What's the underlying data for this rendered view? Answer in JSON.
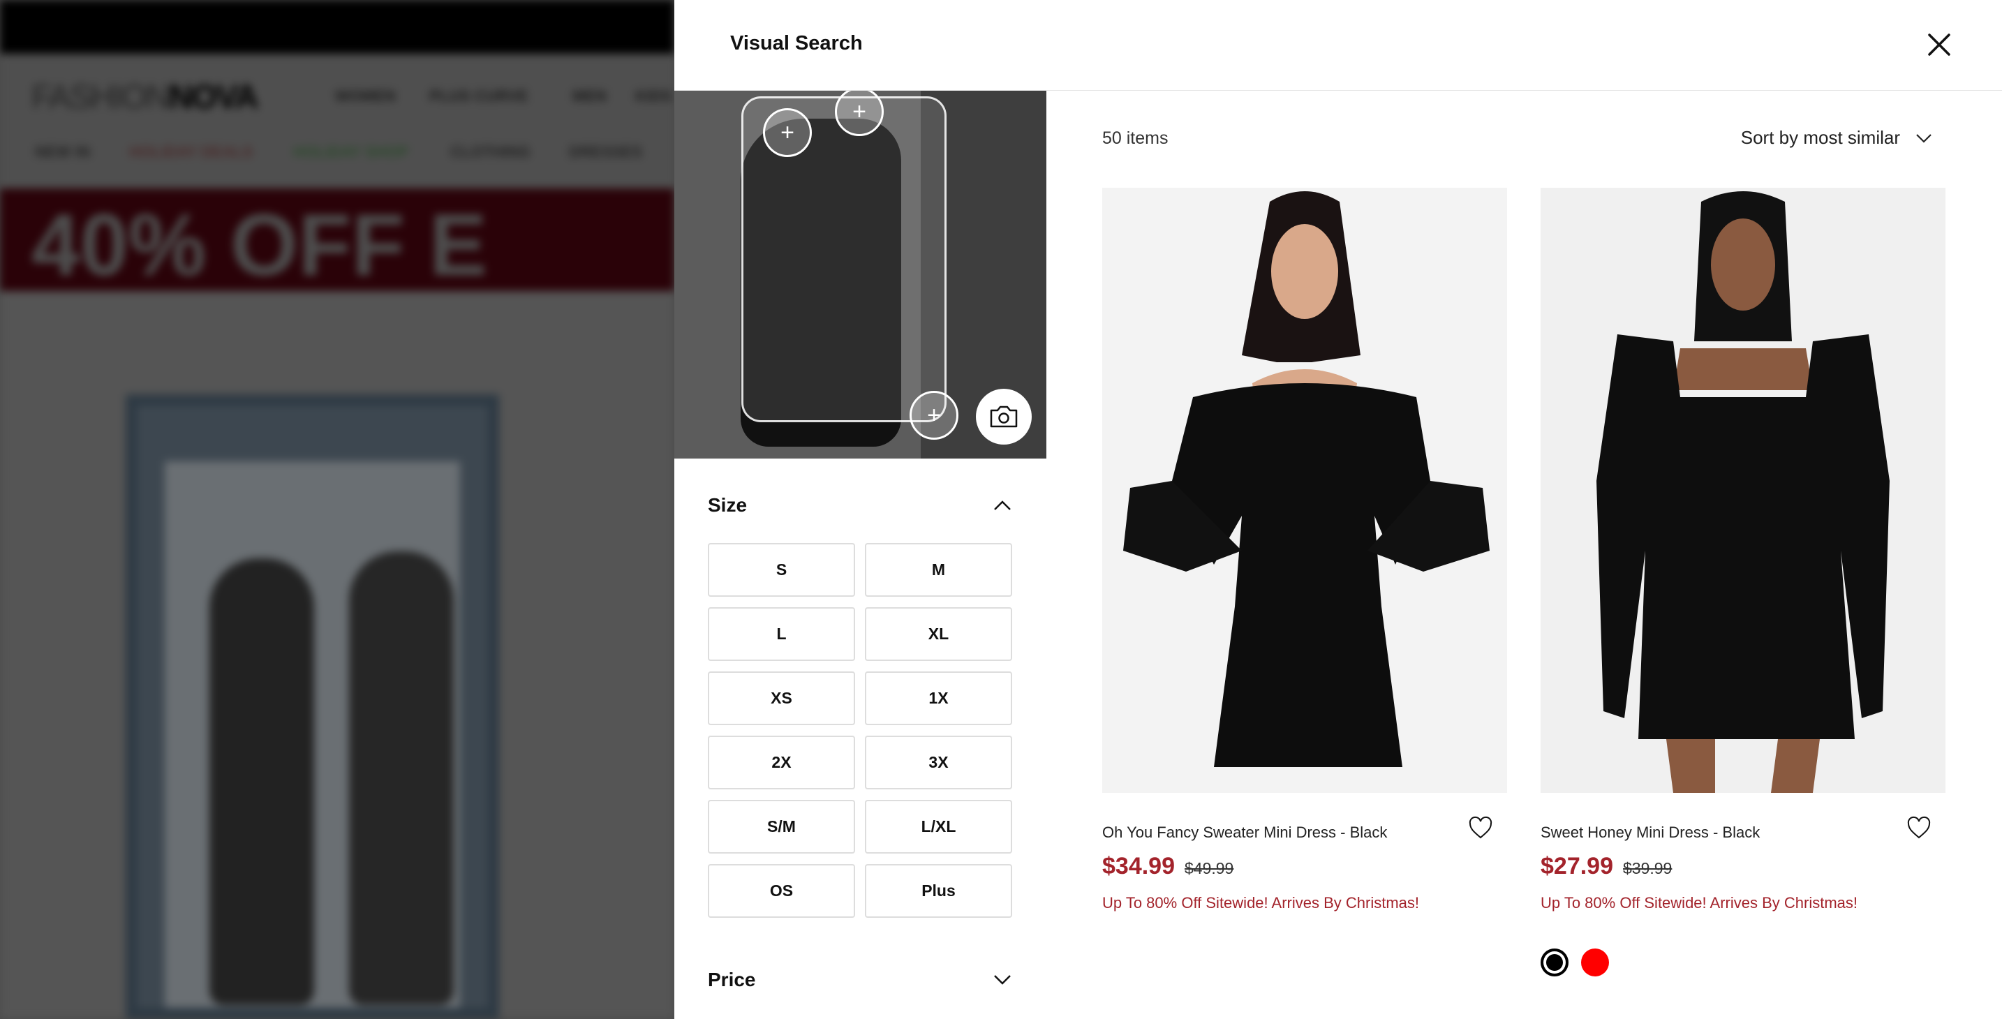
{
  "background_page": {
    "logo_light": "FASHION",
    "logo_bold": "NOVA",
    "nav": [
      "WOMEN",
      "PLUS CURVE",
      "MEN",
      "KIDS"
    ],
    "subnav": [
      "NEW IN",
      "HOLIDAY DEALS",
      "HOLIDAY SHOP",
      "CLOTHING",
      "DRESSES"
    ],
    "banner": "40% OFF E"
  },
  "panel": {
    "title": "Visual Search",
    "close_icon": "close-icon",
    "camera_icon": "camera-icon"
  },
  "filters": {
    "size": {
      "label": "Size",
      "expanded": true,
      "options": [
        "S",
        "M",
        "L",
        "XL",
        "XS",
        "1X",
        "2X",
        "3X",
        "S/M",
        "L/XL",
        "OS",
        "Plus"
      ]
    },
    "price": {
      "label": "Price",
      "expanded": false
    }
  },
  "results": {
    "count": "50 items",
    "sort": "Sort by most similar"
  },
  "products": [
    {
      "name": "Oh You Fancy Sweater Mini Dress - Black",
      "price": "$34.99",
      "original_price": "$49.99",
      "promo": "Up To 80% Off Sitewide! Arrives By Christmas!",
      "swatches": []
    },
    {
      "name": "Sweet Honey Mini Dress - Black",
      "price": "$27.99",
      "original_price": "$39.99",
      "promo": "Up To 80% Off Sitewide! Arrives By Christmas!",
      "swatches": [
        {
          "color": "#000000",
          "selected": true
        },
        {
          "color": "#ff0000",
          "selected": false
        }
      ]
    }
  ],
  "colors": {
    "sale": "#a3232b",
    "overlay": "rgba(0,0,0,0.65)"
  }
}
